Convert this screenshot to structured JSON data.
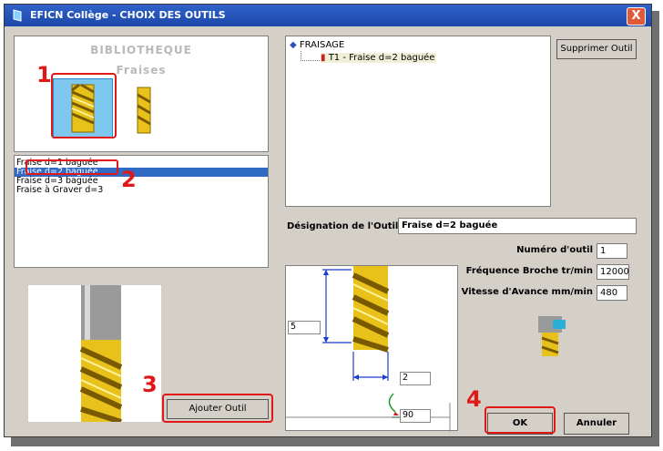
{
  "window": {
    "title": "EFICN Collège - CHOIX DES OUTILS",
    "close_label": "X"
  },
  "library": {
    "title": "BIBLIOTHEQUE",
    "subtitle": "Fraises",
    "items": [
      "Fraise d=1 baguée",
      "Fraise d=2 baguée",
      "Fraise d=3 baguée",
      "Fraise à Graver d=3"
    ],
    "selected_index": 1,
    "add_button": "Ajouter Outil"
  },
  "tree": {
    "root_label": "FRAISAGE",
    "child_label": "T1 - Fraise d=2 baguée"
  },
  "delete_button": "Supprimer Outil",
  "designation": {
    "label": "Désignation de l'Outil",
    "value": "Fraise d=2 baguée"
  },
  "params": {
    "tool_number": {
      "label": "Numéro d'outil",
      "value": "1"
    },
    "spindle": {
      "label": "Fréquence Broche tr/min",
      "value": "12000"
    },
    "feed": {
      "label": "Vitesse d'Avance mm/min",
      "value": "480"
    }
  },
  "dimensions": {
    "length": "5",
    "diameter": "2",
    "angle": "90"
  },
  "buttons": {
    "ok": "OK",
    "cancel": "Annuler"
  },
  "steps": {
    "s1": "1",
    "s2": "2",
    "s3": "3",
    "s4": "4"
  },
  "colors": {
    "highlight": "#e01818",
    "selection": "#316ac5",
    "gold": "#e8c21a"
  }
}
